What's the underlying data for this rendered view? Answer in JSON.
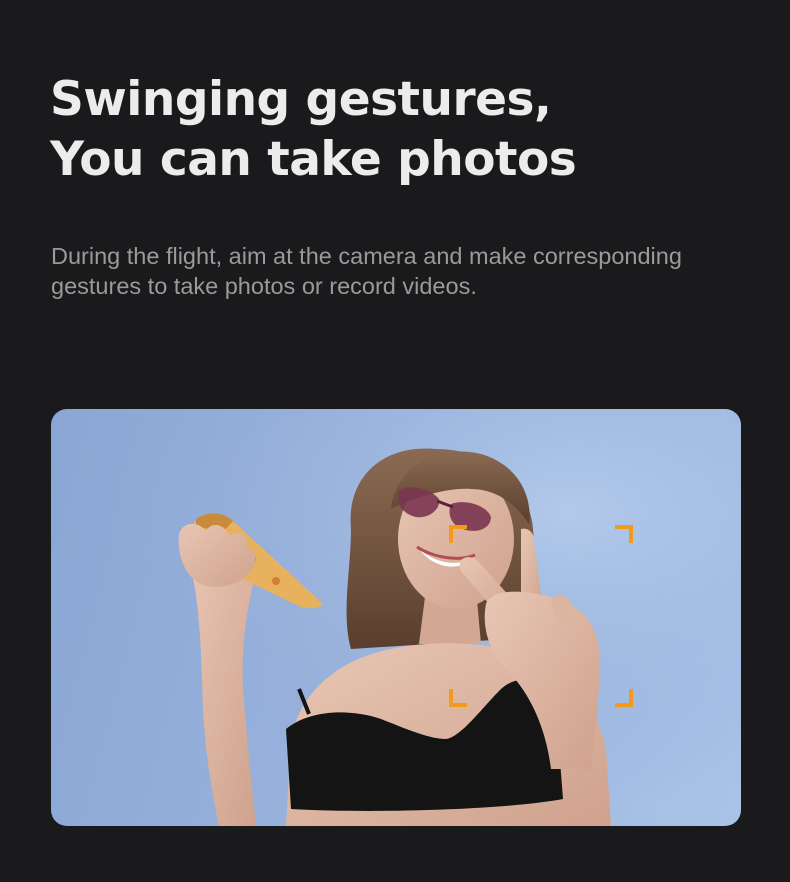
{
  "headline": {
    "line1": "Swinging gestures,",
    "line2": "You can take photos"
  },
  "subtitle": {
    "line1": "During the flight, aim at the camera and make corresponding",
    "line2": "gestures to take photos or record videos."
  },
  "photo": {
    "subject": "woman holding pizza slice making peace-sign gesture against blue sky",
    "focus_frame_color": "#f39a1b"
  },
  "colors": {
    "background": "#1a1a1c",
    "headline": "#ececec",
    "subtitle": "#9a9a9a",
    "sky": "#98b2dc"
  }
}
